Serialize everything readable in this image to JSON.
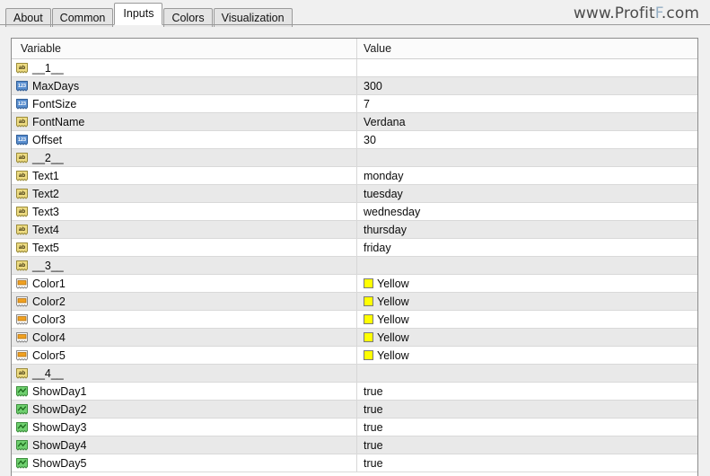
{
  "window": {
    "watermark_prefix": "www.Profit",
    "watermark_accent": "F",
    "watermark_suffix": ".com"
  },
  "tabs": [
    {
      "label": "About",
      "active": false
    },
    {
      "label": "Common",
      "active": false
    },
    {
      "label": "Inputs",
      "active": true
    },
    {
      "label": "Colors",
      "active": false
    },
    {
      "label": "Visualization",
      "active": false
    }
  ],
  "table": {
    "columns": [
      "Variable",
      "Value"
    ],
    "colors": {
      "string_icon": "#EEDC82",
      "int_icon": "#5A8FD0",
      "color_icon": "#F0A020",
      "bool_icon": "#6FD06F",
      "swatch_yellow": "#FFFF00"
    },
    "rows": [
      {
        "icon": "string-type-icon",
        "name": "__1__",
        "value": "",
        "swatch": null
      },
      {
        "icon": "integer-type-icon",
        "name": "MaxDays",
        "value": "300",
        "swatch": null
      },
      {
        "icon": "integer-type-icon",
        "name": "FontSize",
        "value": "7",
        "swatch": null
      },
      {
        "icon": "string-type-icon",
        "name": "FontName",
        "value": "Verdana",
        "swatch": null
      },
      {
        "icon": "integer-type-icon",
        "name": "Offset",
        "value": "30",
        "swatch": null
      },
      {
        "icon": "string-type-icon",
        "name": "__2__",
        "value": "",
        "swatch": null
      },
      {
        "icon": "string-type-icon",
        "name": "Text1",
        "value": "monday",
        "swatch": null
      },
      {
        "icon": "string-type-icon",
        "name": "Text2",
        "value": "tuesday",
        "swatch": null
      },
      {
        "icon": "string-type-icon",
        "name": "Text3",
        "value": "wednesday",
        "swatch": null
      },
      {
        "icon": "string-type-icon",
        "name": "Text4",
        "value": "thursday",
        "swatch": null
      },
      {
        "icon": "string-type-icon",
        "name": "Text5",
        "value": "friday",
        "swatch": null
      },
      {
        "icon": "string-type-icon",
        "name": "__3__",
        "value": "",
        "swatch": null
      },
      {
        "icon": "color-type-icon",
        "name": "Color1",
        "value": "Yellow",
        "swatch": "#FFFF00"
      },
      {
        "icon": "color-type-icon",
        "name": "Color2",
        "value": "Yellow",
        "swatch": "#FFFF00"
      },
      {
        "icon": "color-type-icon",
        "name": "Color3",
        "value": "Yellow",
        "swatch": "#FFFF00"
      },
      {
        "icon": "color-type-icon",
        "name": "Color4",
        "value": "Yellow",
        "swatch": "#FFFF00"
      },
      {
        "icon": "color-type-icon",
        "name": "Color5",
        "value": "Yellow",
        "swatch": "#FFFF00"
      },
      {
        "icon": "string-type-icon",
        "name": "__4__",
        "value": "",
        "swatch": null
      },
      {
        "icon": "bool-type-icon",
        "name": "ShowDay1",
        "value": "true",
        "swatch": null
      },
      {
        "icon": "bool-type-icon",
        "name": "ShowDay2",
        "value": "true",
        "swatch": null
      },
      {
        "icon": "bool-type-icon",
        "name": "ShowDay3",
        "value": "true",
        "swatch": null
      },
      {
        "icon": "bool-type-icon",
        "name": "ShowDay4",
        "value": "true",
        "swatch": null
      },
      {
        "icon": "bool-type-icon",
        "name": "ShowDay5",
        "value": "true",
        "swatch": null
      }
    ]
  }
}
